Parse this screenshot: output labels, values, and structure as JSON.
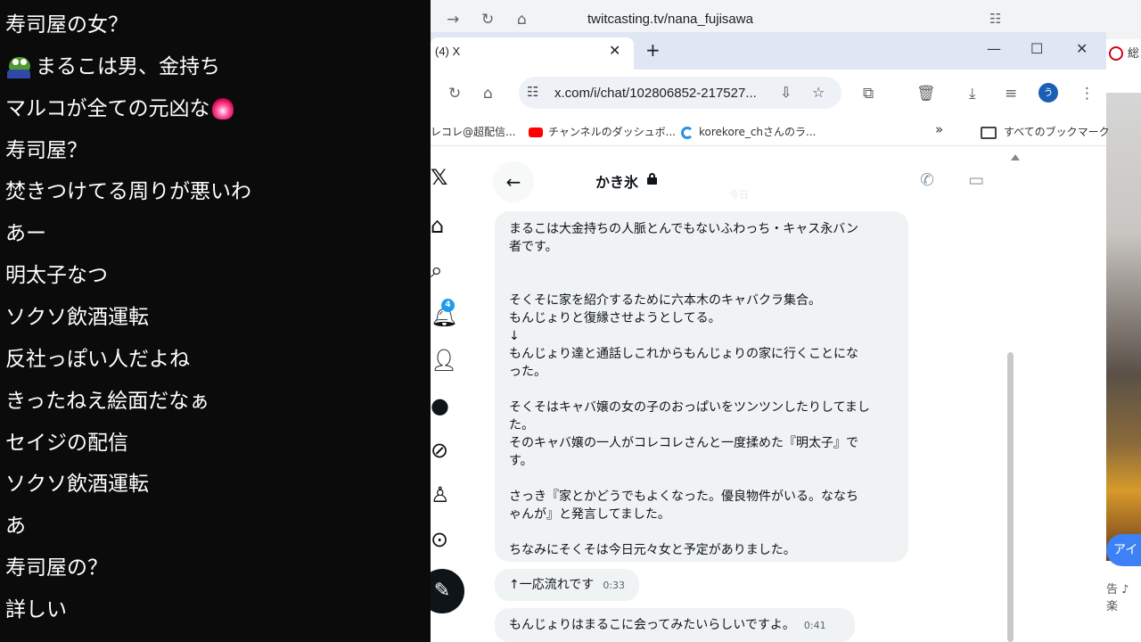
{
  "comments": [
    {
      "text": "寿司屋の女？"
    },
    {
      "text": "まるこは男、金持ち",
      "avatar": "frog-avatar"
    },
    {
      "text": "マルコが全ての元凶な",
      "emoji": "fire-emoji"
    },
    {
      "text": "寿司屋？"
    },
    {
      "text": "焚きつけてる周りが悪いわ"
    },
    {
      "text": "あー"
    },
    {
      "text": "明太子なつ"
    },
    {
      "text": "ソクソ飲酒運転"
    },
    {
      "text": "反社っぽい人だよね"
    },
    {
      "text": "きったねえ絵面だなぁ"
    },
    {
      "text": "セイジの配信"
    },
    {
      "text": "ソクソ飲酒運転"
    },
    {
      "text": "あ"
    },
    {
      "text": "寿司屋の？"
    },
    {
      "text": "詳しい"
    }
  ],
  "back_browser": {
    "url": "twitcasting.tv/nana_fujisawa"
  },
  "right_edge": {
    "top_label": "総",
    "button_label": "アイテ",
    "bottom_label": "告 ♪ 楽"
  },
  "window": {
    "tab_title": "(4) X",
    "url": "x.com/i/chat/102806852-217527...",
    "profile_initial": "う",
    "bookmarks": [
      "レコレ@超配信...",
      "チャンネルのダッシュボ...",
      "korekore_chさんのラ...",
      "すべてのブックマーク"
    ]
  },
  "x_nav": {
    "notification_count": "4"
  },
  "chat": {
    "name": "かき氷",
    "faint_label": "今日",
    "messages": [
      {
        "text": "まるこは大金持ちの人脈とんでもないふわっち・キャス永バン\n者です。\n\n\nそくそに家を紹介するために六本木のキャバクラ集合。\nもんじょりと復縁させようとしてる。\n↓\nもんじょり達と通話しこれからもんじょりの家に行くことにな\nった。\n\nそくそはキャバ嬢の女の子のおっぱいをツンツンしたりしてまし\nた。\nそのキャバ嬢の一人がコレコレさんと一度揉めた『明太子』で\nす。\n\nさっき『家とかどうでもよくなった。優良物件がいる。ななち\nゃんが』と発言してました。\n\nちなみにそくそは今日元々女と予定がありました。",
        "time": ""
      },
      {
        "text": "↑一応流れです",
        "time": "0:33"
      },
      {
        "text": "もんじょりはまるこに会ってみたいらしいですよ。",
        "time": "0:41"
      }
    ]
  }
}
